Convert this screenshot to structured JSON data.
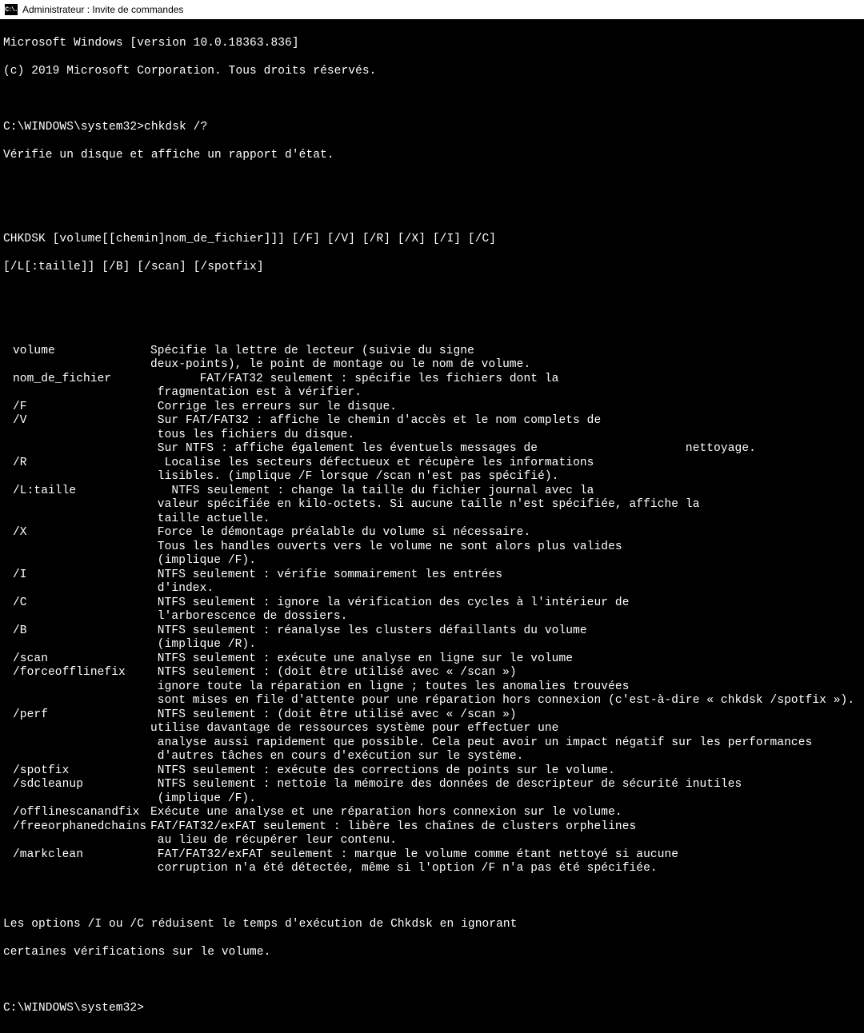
{
  "titlebar": {
    "icon_text": "C:\\.",
    "title": "Administrateur : Invite de commandes"
  },
  "header": {
    "line1": "Microsoft Windows [version 10.0.18363.836]",
    "line2": "(c) 2019 Microsoft Corporation. Tous droits réservés.",
    "prompt1": "C:\\WINDOWS\\system32>chkdsk /?",
    "desc": "Vérifie un disque et affiche un rapport d'état.",
    "syntax1": "CHKDSK [volume[[chemin]nom_de_fichier]]] [/F] [/V] [/R] [/X] [/I] [/C]",
    "syntax2": "[/L[:taille]] [/B] [/scan] [/spotfix]"
  },
  "options": [
    {
      "key": "volume",
      "lines": [
        "Spécifie la lettre de lecteur (suivie du signe",
        "deux-points), le point de montage ou le nom de volume."
      ]
    },
    {
      "key": "nom_de_fichier",
      "lines": [
        "       FAT/FAT32 seulement : spécifie les fichiers dont la",
        " fragmentation est à vérifier."
      ]
    },
    {
      "key": "/F",
      "lines": [
        " Corrige les erreurs sur le disque."
      ]
    },
    {
      "key": "/V",
      "lines": [
        " Sur FAT/FAT32 : affiche le chemin d'accès et le nom complets de",
        " tous les fichiers du disque.",
        " Sur NTFS : affiche également les éventuels messages de                     nettoyage."
      ]
    },
    {
      "key": "/R",
      "lines": [
        "  Localise les secteurs défectueux et récupère les informations",
        " lisibles. (implique /F lorsque /scan n'est pas spécifié)."
      ]
    },
    {
      "key": "/L:taille",
      "lines": [
        "   NTFS seulement : change la taille du fichier journal avec la",
        " valeur spécifiée en kilo-octets. Si aucune taille n'est spécifiée, affiche la",
        " taille actuelle."
      ]
    },
    {
      "key": "/X",
      "lines": [
        " Force le démontage préalable du volume si nécessaire.",
        " Tous les handles ouverts vers le volume ne sont alors plus valides",
        " (implique /F)."
      ]
    },
    {
      "key": "/I",
      "lines": [
        " NTFS seulement : vérifie sommairement les entrées",
        " d'index."
      ]
    },
    {
      "key": "/C",
      "lines": [
        " NTFS seulement : ignore la vérification des cycles à l'intérieur de",
        " l'arborescence de dossiers."
      ]
    },
    {
      "key": "/B",
      "lines": [
        " NTFS seulement : réanalyse les clusters défaillants du volume",
        " (implique /R)."
      ]
    },
    {
      "key": "/scan",
      "lines": [
        " NTFS seulement : exécute une analyse en ligne sur le volume"
      ]
    },
    {
      "key": "/forceofflinefix",
      "lines": [
        " NTFS seulement : (doit être utilisé avec « /scan »)",
        " ignore toute la réparation en ligne ; toutes les anomalies trouvées",
        " sont mises en file d'attente pour une réparation hors connexion (c'est-à-dire « chkdsk /spotfix »)."
      ]
    },
    {
      "key": "/perf",
      "lines": [
        " NTFS seulement : (doit être utilisé avec « /scan »)",
        "utilise davantage de ressources système pour effectuer une",
        " analyse aussi rapidement que possible. Cela peut avoir un impact négatif sur les performances",
        " d'autres tâches en cours d'exécution sur le système."
      ]
    },
    {
      "key": "/spotfix",
      "lines": [
        " NTFS seulement : exécute des corrections de points sur le volume."
      ]
    },
    {
      "key": "/sdcleanup",
      "lines": [
        " NTFS seulement : nettoie la mémoire des données de descripteur de sécurité inutiles",
        " (implique /F)."
      ]
    },
    {
      "key": "/offlinescanandfix",
      "lines": [
        "Exécute une analyse et une réparation hors connexion sur le volume."
      ]
    },
    {
      "key": "/freeorphanedchains",
      "lines": [
        "FAT/FAT32/exFAT seulement : libère les chaînes de clusters orphelines",
        " au lieu de récupérer leur contenu."
      ]
    },
    {
      "key": "/markclean",
      "lines": [
        " FAT/FAT32/exFAT seulement : marque le volume comme étant nettoyé si aucune",
        " corruption n'a été détectée, même si l'option /F n'a pas été spécifiée."
      ]
    }
  ],
  "footer": {
    "line1": "Les options /I ou /C réduisent le temps d'exécution de Chkdsk en ignorant",
    "line2": "certaines vérifications sur le volume.",
    "prompt2": "C:\\WINDOWS\\system32>"
  }
}
